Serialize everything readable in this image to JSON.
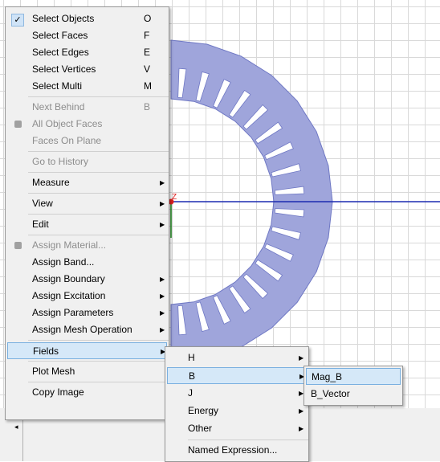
{
  "main_menu": [
    {
      "label": "Select Objects",
      "shortcut": "O",
      "checked": true
    },
    {
      "label": "Select Faces",
      "shortcut": "F"
    },
    {
      "label": "Select Edges",
      "shortcut": "E"
    },
    {
      "label": "Select Vertices",
      "shortcut": "V"
    },
    {
      "label": "Select Multi",
      "shortcut": "M"
    },
    {
      "label": "Next Behind",
      "shortcut": "B",
      "disabled": true
    },
    {
      "label": "All Object Faces",
      "disabled": true,
      "icon": "face-icon"
    },
    {
      "label": "Faces On Plane",
      "disabled": true
    },
    {
      "label": "Go to History",
      "disabled": true
    },
    {
      "label": "Measure",
      "submenu": true
    },
    {
      "label": "View",
      "submenu": true
    },
    {
      "label": "Edit",
      "submenu": true
    },
    {
      "label": "Assign Material...",
      "disabled": true,
      "icon": "material-icon"
    },
    {
      "label": "Assign Band..."
    },
    {
      "label": "Assign Boundary",
      "submenu": true
    },
    {
      "label": "Assign Excitation",
      "submenu": true
    },
    {
      "label": "Assign Parameters",
      "submenu": true
    },
    {
      "label": "Assign Mesh Operation",
      "submenu": true
    },
    {
      "label": "Fields",
      "submenu": true,
      "highlighted": true
    },
    {
      "label": "Plot Mesh"
    },
    {
      "label": "Copy Image"
    }
  ],
  "fields_menu": [
    {
      "label": "H",
      "submenu": true
    },
    {
      "label": "B",
      "submenu": true,
      "highlighted": true
    },
    {
      "label": "J",
      "submenu": true
    },
    {
      "label": "Energy",
      "submenu": true
    },
    {
      "label": "Other",
      "submenu": true
    },
    {
      "label": "Named Expression..."
    }
  ],
  "b_menu": [
    {
      "label": "Mag_B",
      "highlighted": true
    },
    {
      "label": "B_Vector"
    }
  ],
  "axis_label": "Z",
  "colors": {
    "stator": "#9fa5db",
    "stator_edge": "#6f78c4",
    "axis_blue": "#1c2bb0",
    "menu_bg": "#f0f0f0",
    "highlight": "#d5e8f8"
  }
}
